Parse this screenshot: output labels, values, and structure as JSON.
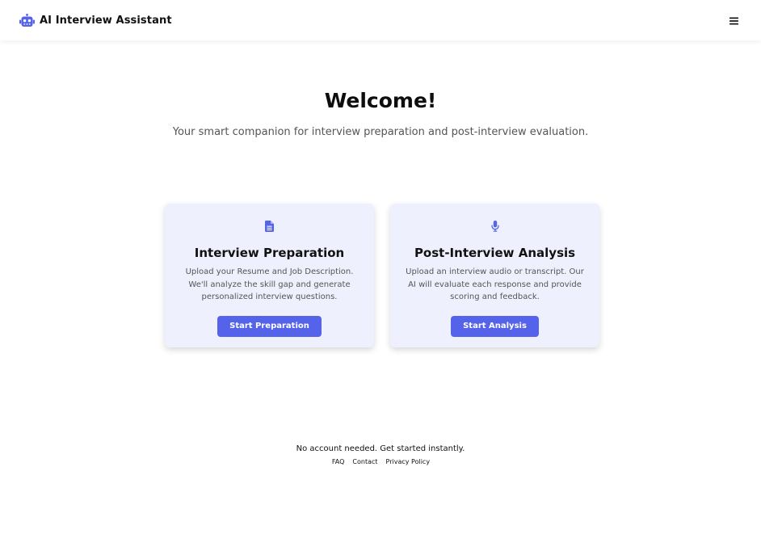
{
  "navbar": {
    "title": "AI Interview Assistant",
    "brand_icon": "robot-icon",
    "menu_icon": "hamburger-menu-icon",
    "accent_color": "#5562ea"
  },
  "hero": {
    "heading": "Welcome!",
    "subheading": "Your smart companion for interview preparation and post-interview evaluation."
  },
  "cards": [
    {
      "icon": "document-icon",
      "title": "Interview Preparation",
      "description": "Upload your Resume and Job Description. We'll analyze the skill gap and generate personalized interview questions.",
      "button_label": "Start Preparation"
    },
    {
      "icon": "microphone-icon",
      "title": "Post-Interview Analysis",
      "description": "Upload an interview audio or transcript. Our AI will evaluate each response and provide scoring and feedback.",
      "button_label": "Start Analysis"
    }
  ],
  "footer": {
    "tagline": "No account needed. Get started instantly.",
    "links": [
      "FAQ",
      "Contact",
      "Privacy Policy"
    ]
  }
}
